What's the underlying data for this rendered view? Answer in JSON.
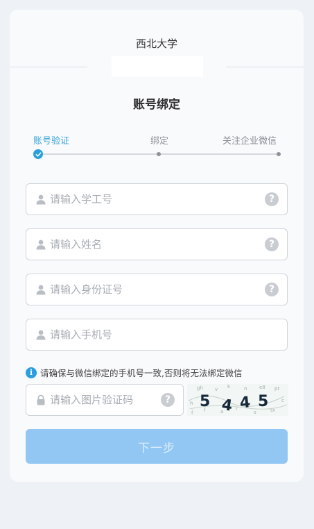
{
  "header": {
    "school_name": "西北大学",
    "page_title": "账号绑定"
  },
  "steps": [
    {
      "label": "账号验证",
      "status": "active"
    },
    {
      "label": "绑定",
      "status": "pending"
    },
    {
      "label": "关注企业微信",
      "status": "pending"
    }
  ],
  "form": {
    "student_id": {
      "placeholder": "请输入学工号",
      "value": ""
    },
    "name": {
      "placeholder": "请输入姓名",
      "value": ""
    },
    "id_card": {
      "placeholder": "请输入身份证号",
      "value": ""
    },
    "phone": {
      "placeholder": "请输入手机号",
      "value": ""
    },
    "captcha": {
      "placeholder": "请输入图片验证码",
      "value": "",
      "image_text": "5445"
    }
  },
  "notice": "请确保与微信绑定的手机号一致,否则将无法绑定微信",
  "submit_label": "下一步",
  "colors": {
    "accent": "#29a0dc",
    "button_disabled": "#92c6f3",
    "step_active_text": "#3aa5d8"
  }
}
